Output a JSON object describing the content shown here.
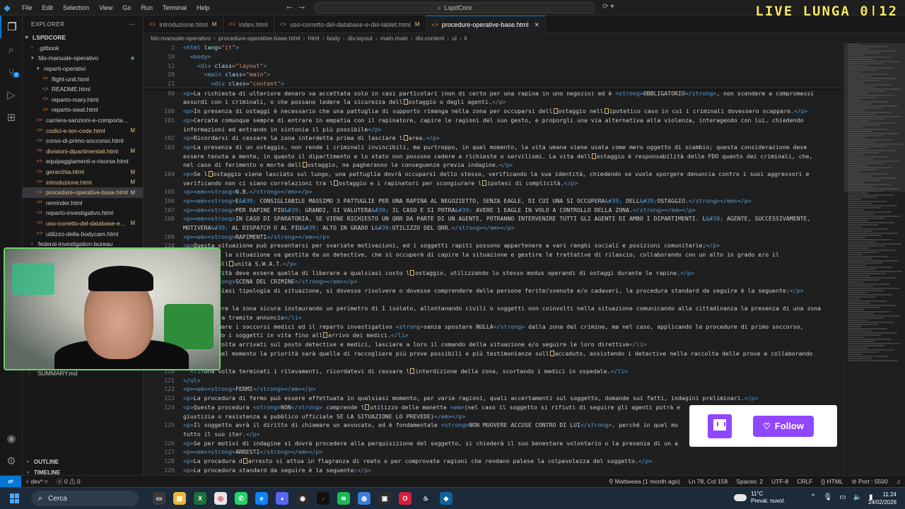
{
  "menu": [
    "File",
    "Edit",
    "Selection",
    "View",
    "Go",
    "Run",
    "Terminal",
    "Help"
  ],
  "command_center": "LspdCore",
  "live_banner": "LIVE LUNGA  0|12",
  "explorer": {
    "title": "EXPLORER",
    "root": "LSPDCORE",
    "items": [
      {
        "label": ".gitbook",
        "type": "folder",
        "indent": 1,
        "collapsed": true,
        "status": ""
      },
      {
        "label": "fdo-manuale-operativo",
        "type": "folder",
        "indent": 1,
        "collapsed": false,
        "status": "dot"
      },
      {
        "label": "reparti-operativi",
        "type": "folder",
        "indent": 2,
        "collapsed": false,
        "status": ""
      },
      {
        "label": "flight-unit.html",
        "type": "file",
        "indent": 3,
        "status": ""
      },
      {
        "label": "README.html",
        "type": "file",
        "indent": 3,
        "status": ""
      },
      {
        "label": "reparto-mary.html",
        "type": "file",
        "indent": 3,
        "status": ""
      },
      {
        "label": "reparto-swat.html",
        "type": "file",
        "indent": 3,
        "status": ""
      },
      {
        "label": "carriera-sanzioni-e-comportamento...",
        "type": "file",
        "indent": 2,
        "status": ""
      },
      {
        "label": "codici-e-ten-code.html",
        "type": "file",
        "indent": 2,
        "status": "M"
      },
      {
        "label": "corso-di-primo-soccorso.html",
        "type": "file",
        "indent": 2,
        "status": ""
      },
      {
        "label": "divisioni-dipartimentali.html",
        "type": "file",
        "indent": 2,
        "status": "M"
      },
      {
        "label": "equipaggiamenti-e-risorse.html",
        "type": "file",
        "indent": 2,
        "status": ""
      },
      {
        "label": "gerarchia.html",
        "type": "file",
        "indent": 2,
        "status": "M"
      },
      {
        "label": "introduzione.html",
        "type": "file",
        "indent": 2,
        "status": "M"
      },
      {
        "label": "procedure-operative-base.html",
        "type": "file",
        "indent": 2,
        "status": "M",
        "selected": true
      },
      {
        "label": "reminder.html",
        "type": "file",
        "indent": 2,
        "status": ""
      },
      {
        "label": "reparto-investigativo.html",
        "type": "file",
        "indent": 2,
        "status": ""
      },
      {
        "label": "uso-corretto-del-database-e...",
        "type": "file",
        "indent": 2,
        "status": "M"
      },
      {
        "label": "utilizzo-della-bodycam.html",
        "type": "file",
        "indent": 2,
        "status": ""
      },
      {
        "label": "federal-investigation-bureau",
        "type": "folder",
        "indent": 1,
        "collapsed": true,
        "status": ""
      }
    ],
    "summary_file": "SUMMARY.md",
    "sections": [
      "OUTLINE",
      "TIMELINE"
    ]
  },
  "tabs": [
    {
      "label": "introduzione.html",
      "modified": "M",
      "active": false
    },
    {
      "label": "index.html",
      "modified": "",
      "active": false
    },
    {
      "label": "uso-corretto-del-database-e-del-tablet.html",
      "modified": "M",
      "active": false
    },
    {
      "label": "procedure-operative-base.html",
      "modified": "",
      "active": true
    }
  ],
  "breadcrumb": [
    "fdo-manuale-operativo",
    "procedure-operative-base.html",
    "html",
    "body",
    "div.layout",
    "main.main",
    "div.content",
    "ul",
    "li"
  ],
  "sticky_lines": [
    {
      "n": "2",
      "html": "<span class='tag'>&lt;html</span> <span class='attr'>lang</span>=<span class='val'>\"it\"</span><span class='tag'>&gt;</span>"
    },
    {
      "n": "10",
      "html": "&nbsp;&nbsp;<span class='tag'>&lt;body&gt;</span>"
    },
    {
      "n": "12",
      "html": "&nbsp;&nbsp;&nbsp;&nbsp;<span class='tag'>&lt;div</span> <span class='attr'>class</span>=<span class='val'>\"layout\"</span><span class='tag'>&gt;</span>"
    },
    {
      "n": "20",
      "html": "&nbsp;&nbsp;&nbsp;&nbsp;&nbsp;&nbsp;<span class='tag'>&lt;main</span> <span class='attr'>class</span>=<span class='val'>\"main\"</span><span class='tag'>&gt;</span>"
    },
    {
      "n": "21",
      "html": "&nbsp;&nbsp;&nbsp;&nbsp;&nbsp;&nbsp;&nbsp;&nbsp;<span class='tag'>&lt;div</span> <span class='attr'>class</span>=<span class='val'>\"content\"</span><span class='tag'>&gt;</span>"
    }
  ],
  "code_lines": [
    {
      "n": "99",
      "html": "<span class='tag'>&lt;p&gt;</span>La richiesta di ulteriore denaro va accettata solo in casi particolari (non di certo per una rapina in uno negozio) ed è <span class='tag'>&lt;strong&gt;</span>OBBLIGATORIO<span class='tag'>&lt;/strong&gt;</span>, non scendere a compromessi"
    },
    {
      "n": "",
      "html": "assurdi con i criminali, o che possano ledere la sicurezza dell<i class='warnbox'></i>ostaggio o degli agenti.<span class='tag'>&lt;/p&gt;</span>"
    },
    {
      "n": "100",
      "html": "<span class='tag'>&lt;p&gt;</span>In presenza di ostaggi è necessario che una pattuglia di supporto rimanga nella zona per occuparsi dell<i class='warnbox'></i>ostaggio nell<i class='warnbox'></i>ipotetico caso in cui i criminali dovessero scappare.<span class='tag'>&lt;/p&gt;</span>"
    },
    {
      "n": "101",
      "html": "<span class='tag'>&lt;p&gt;</span>Cercate comunque sempre di entrare in empatia con il rapinatore, capire le ragioni del suo gesto, e proporgli una via alternativa alla violenza, interagendo con lui, chiedendo"
    },
    {
      "n": "",
      "html": "informazioni ed entrando in sintonia il più possibile<span class='tag'>&lt;/p&gt;</span>"
    },
    {
      "n": "102",
      "html": "<span class='tag'>&lt;p&gt;</span>Ricordarsi di cessare la zona interdetta prima di lasciare l<i class='warnbox'></i>area.<span class='tag'>&lt;/p&gt;</span>"
    },
    {
      "n": "103",
      "html": "<span class='tag'>&lt;p&gt;</span>La presenza di un ostaggio, non rende i criminali invincibili, ma purtroppo, in quel momento, la vita umana viene usata come mero oggetto di scambio; questa considerazione deve"
    },
    {
      "n": "",
      "html": "essere tenuta a mente, in quanto il dipartimento e lo stato non possono cedere a richieste o servilismi. La vita dell<i class='warnbox'></i>ostaggio è responsabilità delle FDO quanto dei criminali, che,"
    },
    {
      "n": "",
      "html": "nel caso di ferimento o morte dell<i class='warnbox'></i>ostaggio, ne pagheranno le conseguenze previa indagine.<span class='tag'>&lt;/p&gt;</span>"
    },
    {
      "n": "104",
      "html": "<span class='tag'>&lt;p&gt;</span>Se l<i class='warnbox'></i>ostaggio viene lasciato sul luogo, una pattuglia dovrà occuparsi dello stesso, verificando la sua identità, chiedendo se vuole sporgere denuncia contro i suoi aggressori e"
    },
    {
      "n": "",
      "html": "verificando non ci siano correlazioni tra l<i class='warnbox'></i>ostaggio e i rapinatori per scongiurare l<i class='warnbox'></i>ipotesi di complicità.<span class='tag'>&lt;/p&gt;</span>"
    },
    {
      "n": "105",
      "html": "<span class='tag'>&lt;p&gt;&lt;em&gt;&lt;strong&gt;</span>N.B.<span class='tag'>&lt;/strong&gt;&lt;/em&gt;&lt;/p&gt;</span>"
    },
    {
      "n": "106",
      "html": "<span class='tag'>&lt;p&gt;&lt;em&gt;&lt;strong&gt;</span>E<span class='ent'>&amp;#39;</span> CONSIGLIABILE MASSIMO 3 PATTUGLIE PER UNA RAPINA AL NEGOZIETTO, SENZA EAGLE, DI CUI UNA SI OCCUPERA<span class='ent'>&amp;#39;</span> DELL<span class='ent'>&amp;#39;</span>OSTAGGIO.<span class='tag'>&lt;/strong&gt;&lt;/em&gt;&lt;/p&gt;</span>"
    },
    {
      "n": "107",
      "html": "<span class='tag'>&lt;p&gt;&lt;em&gt;&lt;strong&gt;</span>PER RAPINE PIU<span class='ent'>&amp;#39;</span> GRANDI, SI VALUTERA<span class='ent'>&amp;#39;</span> IL CASO E SI POTRA<span class='ent'>&amp;#39;</span> AVERE 1 EAGLE IN VOLO A CONTROLLO DELLA ZONA.<span class='tag'>&lt;/strong&gt;&lt;/em&gt;&lt;/p&gt;</span>"
    },
    {
      "n": "108",
      "html": "<span class='tag'>&lt;p&gt;&lt;em&gt;&lt;strong&gt;</span>IN CASO DI SPARATORIA, SE VIENE RICHIESTO UN QRR DA PARTE DI UN AGENTE, POTRANNO INTERVENIRE TUTTI GLI AGENTI DI AMBO I DIPARTIMENTI. L<span class='ent'>&amp;#39;</span> AGENTE, SUCCESSIVAMENTE,"
    },
    {
      "n": "",
      "html": "MOTIVERA<span class='ent'>&amp;#39;</span> AL DISPATCH O AL PIU<span class='ent'>&amp;#39;</span> ALTO IN GRADO L<span class='ent'>&amp;#39;</span>UTILIZZO DEL QRR.<span class='tag'>&lt;/strong&gt;&lt;/em&gt;&lt;/p&gt;</span>"
    },
    {
      "n": "109",
      "html": "<span class='tag'>&lt;p&gt;&lt;em&gt;&lt;strong&gt;</span>RAPIMENTI<span class='tag'>&lt;/strong&gt;&lt;/em&gt;&lt;/p&gt;</span>"
    },
    {
      "n": "110",
      "html": "<span class='tag'>&lt;p&gt;</span>Questa situazione può presentarsi per svariate motivazioni, ed i soggetti rapiti possono appartenere a vari ranghi sociali e posizioni comunitarie;<span class='tag'>&lt;/p&gt;</span>"
    },
    {
      "n": "111",
      "html": "<span class='tag'>&lt;p&gt;</span>Di base, la situazione va gestita da un detective, che si occuperà di capire la situazione e gestire le trattative di rilascio, collaborando con un alto in grado e/o il"
    },
    {
      "n": "",
      "html": "supporto dell<i class='warnbox'></i>unità S.W.A.T.<span class='tag'>&lt;/p&gt;</span>"
    },
    {
      "n": "112",
      "html": "<span class='tag'>&lt;p&gt;</span>La priorità deve essere quella di liberare a qualsiasi costo l<i class='warnbox'></i>ostaggio, utilizzando lo stesso modus operandi di ostaggi durante le rapine.<span class='tag'>&lt;/p&gt;</span>"
    },
    {
      "n": "113",
      "html": "<span class='tag'>&lt;p&gt;&lt;em&gt;&lt;strong&gt;</span>SCENA DEL CRIMINE<span class='tag'>&lt;/strong&gt;&lt;/em&gt;&lt;/p&gt;</span>"
    },
    {
      "n": "114",
      "html": "<span class='tag'>&lt;p&gt;</span>In qualsiasi tipologia di situazione, si dovesse risolvere o dovesse comprendere delle persone ferite/svenute e/o cadaveri, la procedura standard da seguire è la seguente:<span class='tag'>&lt;/p&gt;</span>"
    },
    {
      "n": "115",
      "html": "<span class='tag'>&lt;ul&gt;</span>"
    },
    {
      "n": "116",
      "html": "&nbsp;&nbsp;<span class='tag'>&lt;li&gt;</span>Rendere la zona sicura instaurando un perimetro di 1 isolato, allontanando civili o soggetti non coinvolti nella situazione comunicando alla cittadinanza la presenza di una zona"
    },
    {
      "n": "",
      "html": "&nbsp;&nbsp;interdetta tramite annuncio<span class='tag'>&lt;/li&gt;</span>"
    },
    {
      "n": "117",
      "html": "&nbsp;&nbsp;<span class='tag'>&lt;li&gt;</span>Chiamare i soccorsi medici ed il reparto investigativo <span class='tag'>&lt;strong&gt;</span>senza spostare NULLA<span class='tag'>&lt;/strong&gt;</span> dalla zona del crimine, ma nel caso, applicando le procedure di primo soccorso,"
    },
    {
      "n": "",
      "html": "&nbsp;&nbsp;mantenendo i soggetti in vita fino all<i class='warnbox'></i>arrivo dei medici.<span class='tag'>&lt;/li&gt;</span>"
    },
    {
      "n": "118",
      "html": "&nbsp;&nbsp;<span class='tag'>&lt;li&gt;</span>Una volta arrivati sul posto detective e medici, lasciare a loro il comando della situazione e/o seguire le loro direttive<span class='tag'>&lt;/li&gt;</span>"
    },
    {
      "n": "119",
      "html": "&nbsp;&nbsp;<span class='tag'>&lt;li&gt;</span>In quel momento la priorità sarà quella di raccogliere più prove possibili e più testimonianze sull<i class='warnbox'></i>accaduto, assistendo i detective nella raccolta delle prove e collaborando"
    },
    {
      "n": "",
      "html": ""
    },
    {
      "n": "120",
      "html": "&nbsp;&nbsp;<span class='tag'>&lt;li&gt;</span>Una volta terminati i rilevamenti, ricordatevi di cessare l<i class='warnbox'></i>interdizione della zona, scortando i medici in ospedale.<span class='tag'>&lt;/li&gt;</span>"
    },
    {
      "n": "121",
      "html": "<span class='tag'>&lt;/ul&gt;</span>"
    },
    {
      "n": "122",
      "html": "<span class='tag'>&lt;p&gt;&lt;em&gt;&lt;strong&gt;</span>FERMI<span class='tag'>&lt;/strong&gt;&lt;/em&gt;&lt;/p&gt;</span>"
    },
    {
      "n": "123",
      "html": "<span class='tag'>&lt;p&gt;</span>La procedura di fermo può essere effettuata in qualsiasi momento, per varie ragioni, quali accertamenti sul soggetto, domande sui fatti, indagini preliminari.<span class='tag'>&lt;/p&gt;</span>"
    },
    {
      "n": "124",
      "html": "<span class='tag'>&lt;p&gt;</span>Questa procedura <span class='tag'>&lt;strong&gt;</span>NON<span class='tag'>&lt;/strong&gt;</span> comprende l<i class='warnbox'></i>utilizzo delle manette <span class='tag'>&lt;em&gt;</span>(nel caso il soggetto si rifiuti di seguire gli agenti potrà e"
    },
    {
      "n": "",
      "html": "giustizia o resistenza a pubblico ufficiale SE LA SITUAZIONE LO PREVEDE)<span class='tag'>&lt;/em&gt;&lt;/p&gt;</span>"
    },
    {
      "n": "125",
      "html": "<span class='tag'>&lt;p&gt;</span>Il soggetto avrà il diritto di chiamare un avvocato, ed è fondamentale <span class='tag'>&lt;strong&gt;</span>NON MUOVERE ACCUSE CONTRO DI LUI<span class='tag'>&lt;/strong&gt;</span>, perché in quel mo"
    },
    {
      "n": "",
      "html": "tutto il suo iter.<span class='tag'>&lt;/p&gt;</span>"
    },
    {
      "n": "126",
      "html": "<span class='tag'>&lt;p&gt;</span>Se per motivi di indagine si dovrà procedere alla perquisizione del soggetto, si chiederà il suo benestare volontario o la presenza di un a"
    },
    {
      "n": "127",
      "html": "<span class='tag'>&lt;p&gt;&lt;em&gt;&lt;strong&gt;</span>ARRESTI<span class='tag'>&lt;/strong&gt;&lt;/em&gt;&lt;/p&gt;</span>"
    },
    {
      "n": "128",
      "html": "<span class='tag'>&lt;p&gt;</span>La procedura d<i class='warnbox'></i>arresto si attua in flagranza di reato o per comprovate ragioni che rendano palese la colpevolezza del soggetto.<span class='tag'>&lt;/p&gt;</span>"
    },
    {
      "n": "129",
      "html": "<span class='tag'>&lt;p&gt;</span>La procedura standard da seguire è la seguente:<span class='tag'>&lt;/p&gt;</span>"
    }
  ],
  "follow": {
    "label": "Follow"
  },
  "statusbar": {
    "branch": "dev*",
    "errors": "0",
    "warnings": "0",
    "blame": "Mattweea (1 month ago)",
    "position": "Ln 78, Col 158",
    "spaces": "Spaces: 2",
    "encoding": "UTF-8",
    "eol": "CRLF",
    "language": "HTML",
    "port": "Port : 5500"
  },
  "taskbar": {
    "search": "Cerca",
    "weather_temp": "11°C",
    "weather_desc": "Preval. nuvol.",
    "time": "11:24",
    "date": "24/02/2026"
  }
}
